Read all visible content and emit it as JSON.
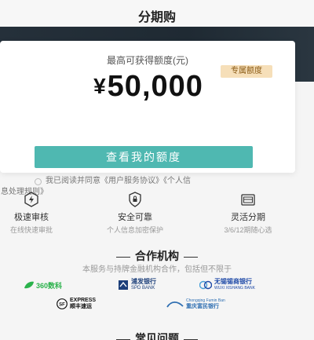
{
  "header": {
    "title": "分期购"
  },
  "card": {
    "limit_label": "最高可获得额度(元)",
    "badge": "专属额度",
    "currency": "¥",
    "amount": "50,000",
    "cta": "查看我的额度",
    "agree_line1": "我已阅读并同意《用户服务协议》《个人信",
    "agree_line2": "息处理规则》"
  },
  "features": [
    {
      "title": "极速审核",
      "sub": "在线快速审批",
      "icon": "lightning-icon"
    },
    {
      "title": "安全可靠",
      "sub": "个人信息加密保护",
      "icon": "shield-lock-icon"
    },
    {
      "title": "灵活分期",
      "sub": "3/6/12期随心选",
      "icon": "calendar-card-icon"
    }
  ],
  "partners": {
    "title": "合作机构",
    "subtitle": "本服务与持牌金融机构合作，包括但不限于",
    "logos": [
      {
        "name": "360数科",
        "color": "#2bb24c"
      },
      {
        "name": "浦发银行",
        "sub": "SPD BANK",
        "color": "#1c3f7a"
      },
      {
        "name": "无锡锡商银行",
        "sub": "WUXI XISHANG BANK",
        "color": "#1f4aa8"
      },
      {
        "name": "顺丰速运",
        "sub": "EXPRESS",
        "color": "#111111"
      },
      {
        "name": "重庆富民银行",
        "sub": "Chongqing Fumin Ban",
        "color": "#2f6fb2"
      }
    ]
  },
  "faq": {
    "title": "常见问题"
  }
}
